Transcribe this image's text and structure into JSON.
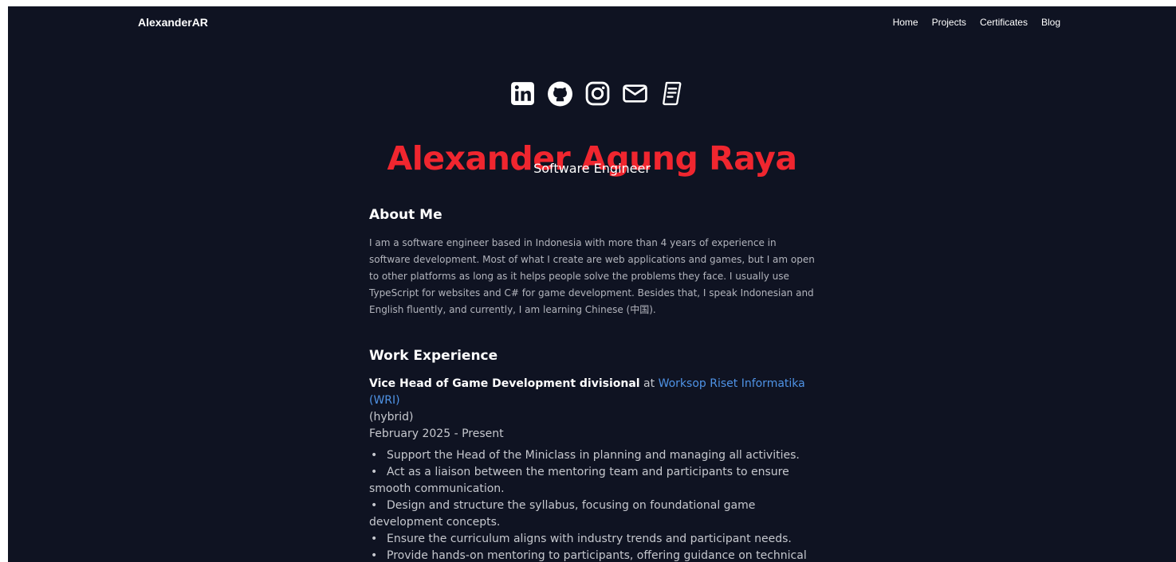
{
  "navbar": {
    "brand": "AlexanderAR",
    "links": [
      "Home",
      "Projects",
      "Certificates",
      "Blog"
    ]
  },
  "social": {
    "icons": [
      "linkedin-icon",
      "github-icon",
      "instagram-icon",
      "mail-icon",
      "document-icon"
    ]
  },
  "hero": {
    "name": "Alexander Agung Raya",
    "role": "Software Engineer"
  },
  "about": {
    "title": "About Me",
    "text": "I am a software engineer based in Indonesia with more than 4 years of experience in software development. Most of what I create are web applications and games, but I am open to other platforms as long as it helps people solve the problems they face. I usually use TypeScript for websites and C# for game development. Besides that, I speak Indonesian and English fluently, and currently, I am learning Chinese (中国)."
  },
  "work": {
    "title": "Work Experience",
    "jobs": [
      {
        "title": "Vice Head of Game Development divisional",
        "at": "at",
        "company": "Worksop Riset Informatika (WRI)",
        "mode": "(hybrid)",
        "date": "February 2025 - Present",
        "duties": [
          "Support the Head of the Miniclass in planning and managing all activities.",
          "Act as a liaison between the mentoring team and participants to ensure smooth communication.",
          "Design and structure the syllabus, focusing on foundational game development concepts.",
          "Ensure the curriculum aligns with industry trends and participant needs.",
          "Provide hands-on mentoring to participants, offering guidance on technical and creative aspects of game development."
        ]
      }
    ]
  },
  "colors": {
    "background": "#0f1322",
    "accent": "#f0262f",
    "link": "#4f93e6"
  }
}
